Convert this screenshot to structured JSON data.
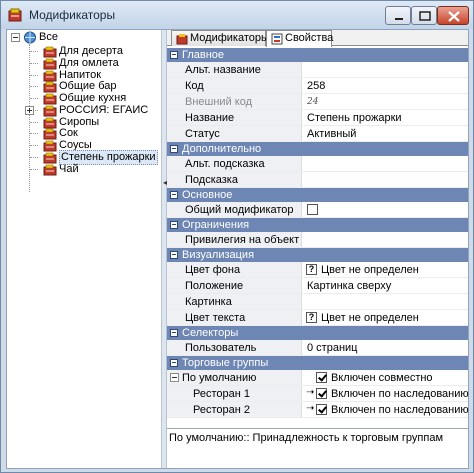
{
  "window": {
    "title": "Модификаторы",
    "buttons": {
      "minimize": "minimize",
      "maximize": "maximize",
      "close": "close"
    }
  },
  "tree": {
    "root": {
      "label": "Все",
      "icon": "globe-folder-icon"
    },
    "items": [
      {
        "label": "Для десерта",
        "icon": "folder-icon"
      },
      {
        "label": "Для омлета",
        "icon": "folder-icon"
      },
      {
        "label": "Напиток",
        "icon": "folder-icon"
      },
      {
        "label": "Общие бар",
        "icon": "folder-icon"
      },
      {
        "label": "Общие кухня",
        "icon": "folder-icon"
      },
      {
        "label": "РОССИЯ: ЕГАИС",
        "icon": "folder-icon",
        "expandable": true
      },
      {
        "label": "Сиропы",
        "icon": "folder-icon"
      },
      {
        "label": "Сок",
        "icon": "folder-icon"
      },
      {
        "label": "Соусы",
        "icon": "folder-icon"
      },
      {
        "label": "Степень прожарки",
        "icon": "folder-icon",
        "selected": true
      },
      {
        "label": "Чай",
        "icon": "folder-icon"
      }
    ]
  },
  "tabs": [
    {
      "label": "Модификаторы",
      "icon": "modifiers-icon",
      "active": false
    },
    {
      "label": "Свойства",
      "icon": "properties-icon",
      "active": true
    }
  ],
  "sections": {
    "main": "Главное",
    "extra": "Дополнительно",
    "basic": "Основное",
    "limits": "Ограничения",
    "visual": "Визуализация",
    "selectors": "Селекторы",
    "trade": "Торговые группы"
  },
  "props": {
    "alt_name": {
      "label": "Альт. название",
      "value": ""
    },
    "code": {
      "label": "Код",
      "value": "258"
    },
    "ext_code": {
      "label": "Внешний код",
      "value": "24"
    },
    "name": {
      "label": "Название",
      "value": "Степень прожарки"
    },
    "status": {
      "label": "Статус",
      "value": "Активный"
    },
    "alt_hint": {
      "label": "Альт. подсказка",
      "value": ""
    },
    "hint": {
      "label": "Подсказка",
      "value": ""
    },
    "common_mod": {
      "label": "Общий модификатор",
      "checked": false
    },
    "privilege": {
      "label": "Привилегия на объект",
      "value": ""
    },
    "bg_color": {
      "label": "Цвет фона",
      "value": "Цвет не определен"
    },
    "position": {
      "label": "Положение",
      "value": "Картинка сверху"
    },
    "picture": {
      "label": "Картинка",
      "value": ""
    },
    "text_color": {
      "label": "Цвет текста",
      "value": "Цвет не определен"
    },
    "user": {
      "label": "Пользователь",
      "value": "0 страниц"
    },
    "default": {
      "label": "По умолчанию",
      "value": "Включен совместно",
      "checked": true
    },
    "rest1": {
      "label": "Ресторан 1",
      "value": "Включен по наследованию",
      "checked": true
    },
    "rest2": {
      "label": "Ресторан 2",
      "value": "Включен по наследованию",
      "checked": true
    }
  },
  "status_text": "По умолчанию:: Принадлежность к торговым группам",
  "colors": {
    "section_header": "#6d86b3",
    "title_bar": "#c3d4e8",
    "close_button": "#c6432a"
  }
}
